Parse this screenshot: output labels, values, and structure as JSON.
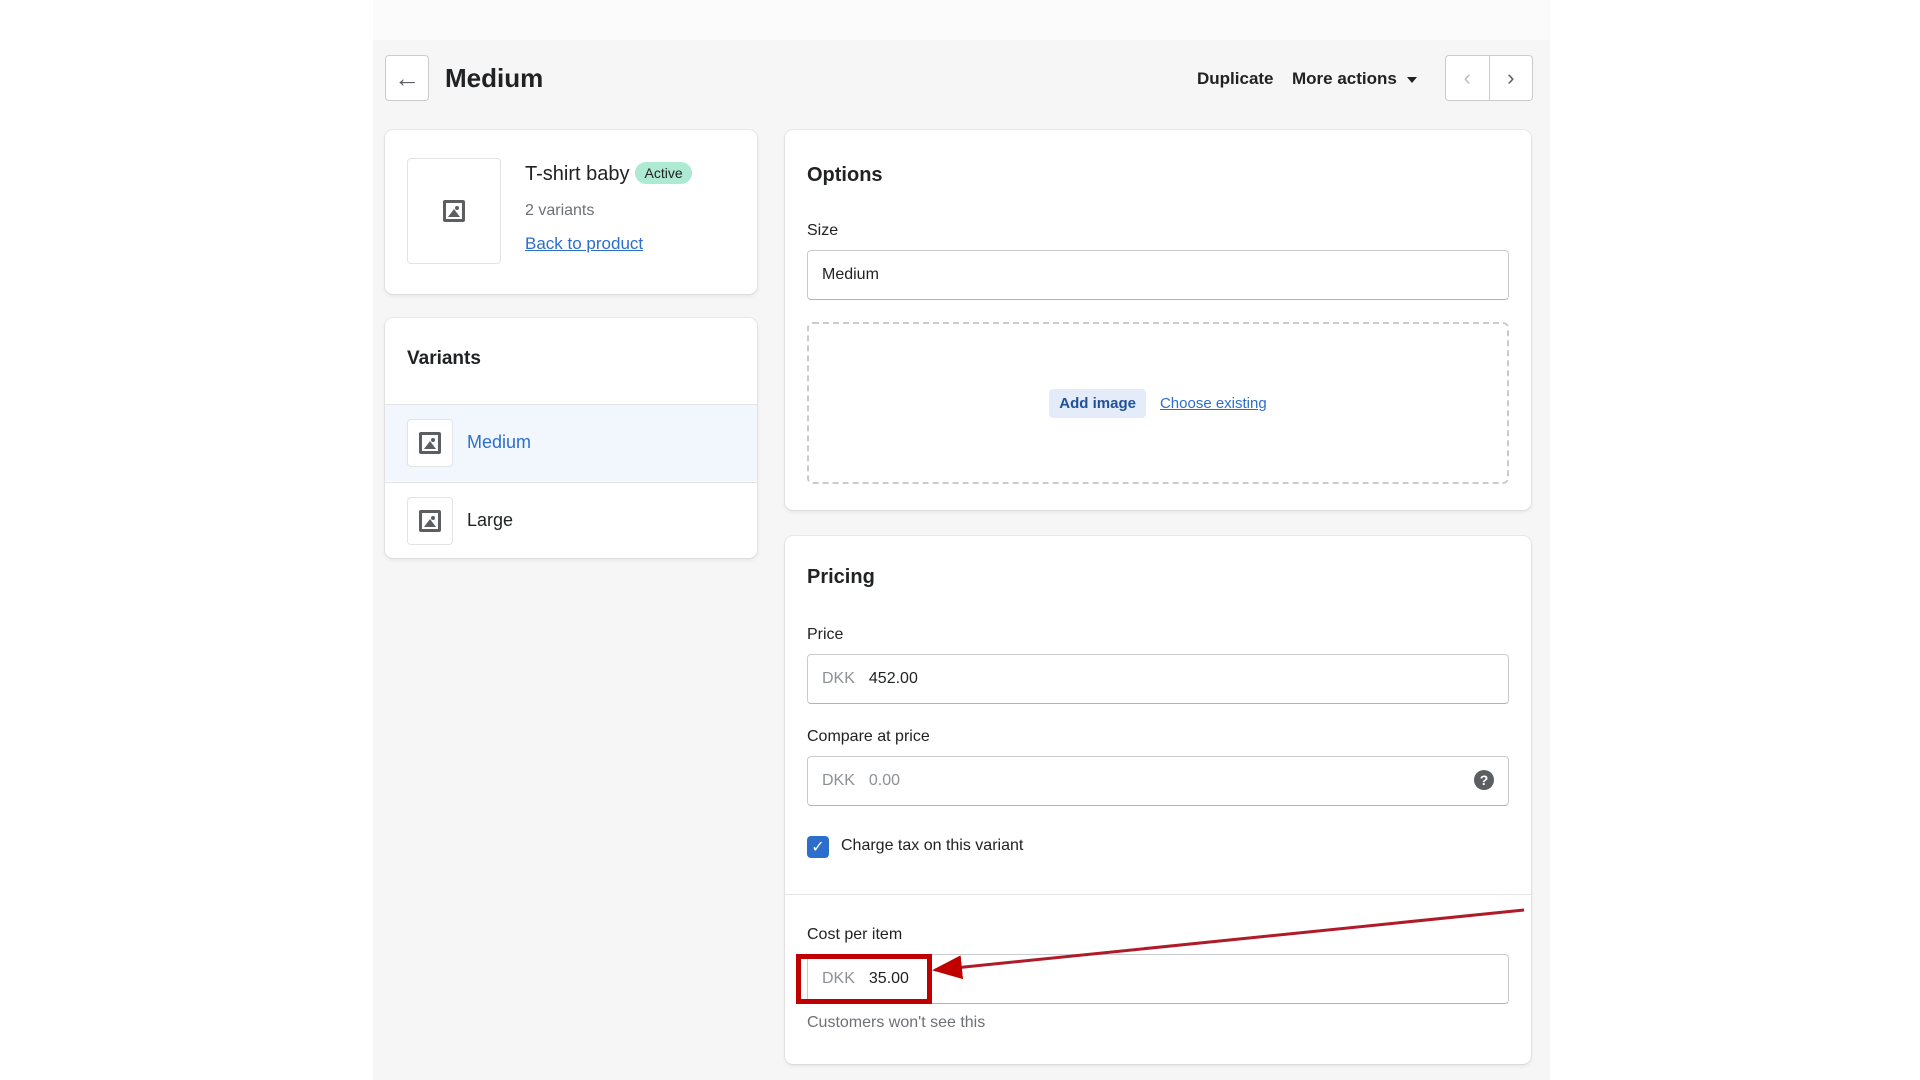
{
  "header": {
    "back_icon": "arrow-left-icon",
    "title": "Medium",
    "duplicate_label": "Duplicate",
    "more_actions_label": "More actions",
    "prev_icon": "chevron-left-icon",
    "next_icon": "chevron-right-icon"
  },
  "product": {
    "name": "T-shirt baby",
    "status": "Active",
    "variant_count": "2 variants",
    "back_link": "Back to product",
    "status_color": "#aee9d1"
  },
  "variants": {
    "title": "Variants",
    "items": [
      {
        "label": "Medium",
        "selected": true
      },
      {
        "label": "Large",
        "selected": false
      }
    ]
  },
  "options": {
    "title": "Options",
    "size_label": "Size",
    "size_value": "Medium",
    "add_image": "Add image",
    "choose_existing": "Choose existing"
  },
  "pricing": {
    "title": "Pricing",
    "price_label": "Price",
    "currency": "DKK",
    "price_value": "452.00",
    "compare_label": "Compare at price",
    "compare_placeholder": "0.00",
    "charge_tax_label": "Charge tax on this variant",
    "charge_tax_checked": true,
    "cost_label": "Cost per item",
    "cost_value": "35.00",
    "cost_hint": "Customers won't see this"
  },
  "annotation": {
    "color": "#c00000"
  }
}
